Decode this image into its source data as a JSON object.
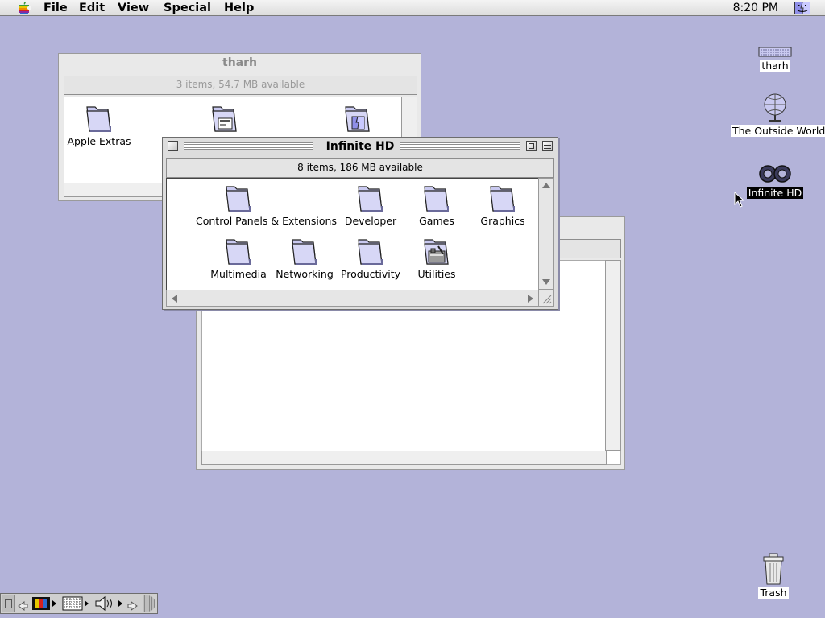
{
  "menubar": {
    "apple_icon": "apple-logo-icon",
    "items": [
      "File",
      "Edit",
      "View",
      "Special",
      "Help"
    ],
    "clock": "8:20 PM",
    "app_icon": "finder-icon"
  },
  "windows": {
    "tharh": {
      "title": "tharh",
      "info": "3 items, 54.7 MB available",
      "items": [
        {
          "label": "Apple Extras",
          "icon": "folder-icon"
        },
        {
          "label": "",
          "icon": "applications-folder-icon"
        },
        {
          "label": "",
          "icon": "system-folder-icon"
        }
      ]
    },
    "infinite_hd": {
      "title": "Infinite HD",
      "info": "8 items, 186 MB available",
      "items": [
        {
          "label": "Control Panels & Extensions",
          "icon": "folder-icon"
        },
        {
          "label": "Developer",
          "icon": "folder-icon"
        },
        {
          "label": "Games",
          "icon": "folder-icon"
        },
        {
          "label": "Graphics",
          "icon": "folder-icon"
        },
        {
          "label": "Multimedia",
          "icon": "folder-icon"
        },
        {
          "label": "Networking",
          "icon": "folder-icon"
        },
        {
          "label": "Productivity",
          "icon": "folder-icon"
        },
        {
          "label": "Utilities",
          "icon": "utilities-folder-icon"
        }
      ]
    },
    "background_window": {
      "title": ""
    }
  },
  "desktop": {
    "icons": [
      {
        "label": "tharh",
        "icon": "server-volume-icon",
        "selected": false
      },
      {
        "label": "The Outside World",
        "icon": "network-globe-icon",
        "selected": false
      },
      {
        "label": "Infinite HD",
        "icon": "hard-disk-icon",
        "selected": true
      },
      {
        "label": "Trash",
        "icon": "trash-icon",
        "selected": false
      }
    ]
  },
  "colors": {
    "desktop": "#b3b3d9",
    "folder": "#c9c9f0",
    "selection": "#000000"
  }
}
